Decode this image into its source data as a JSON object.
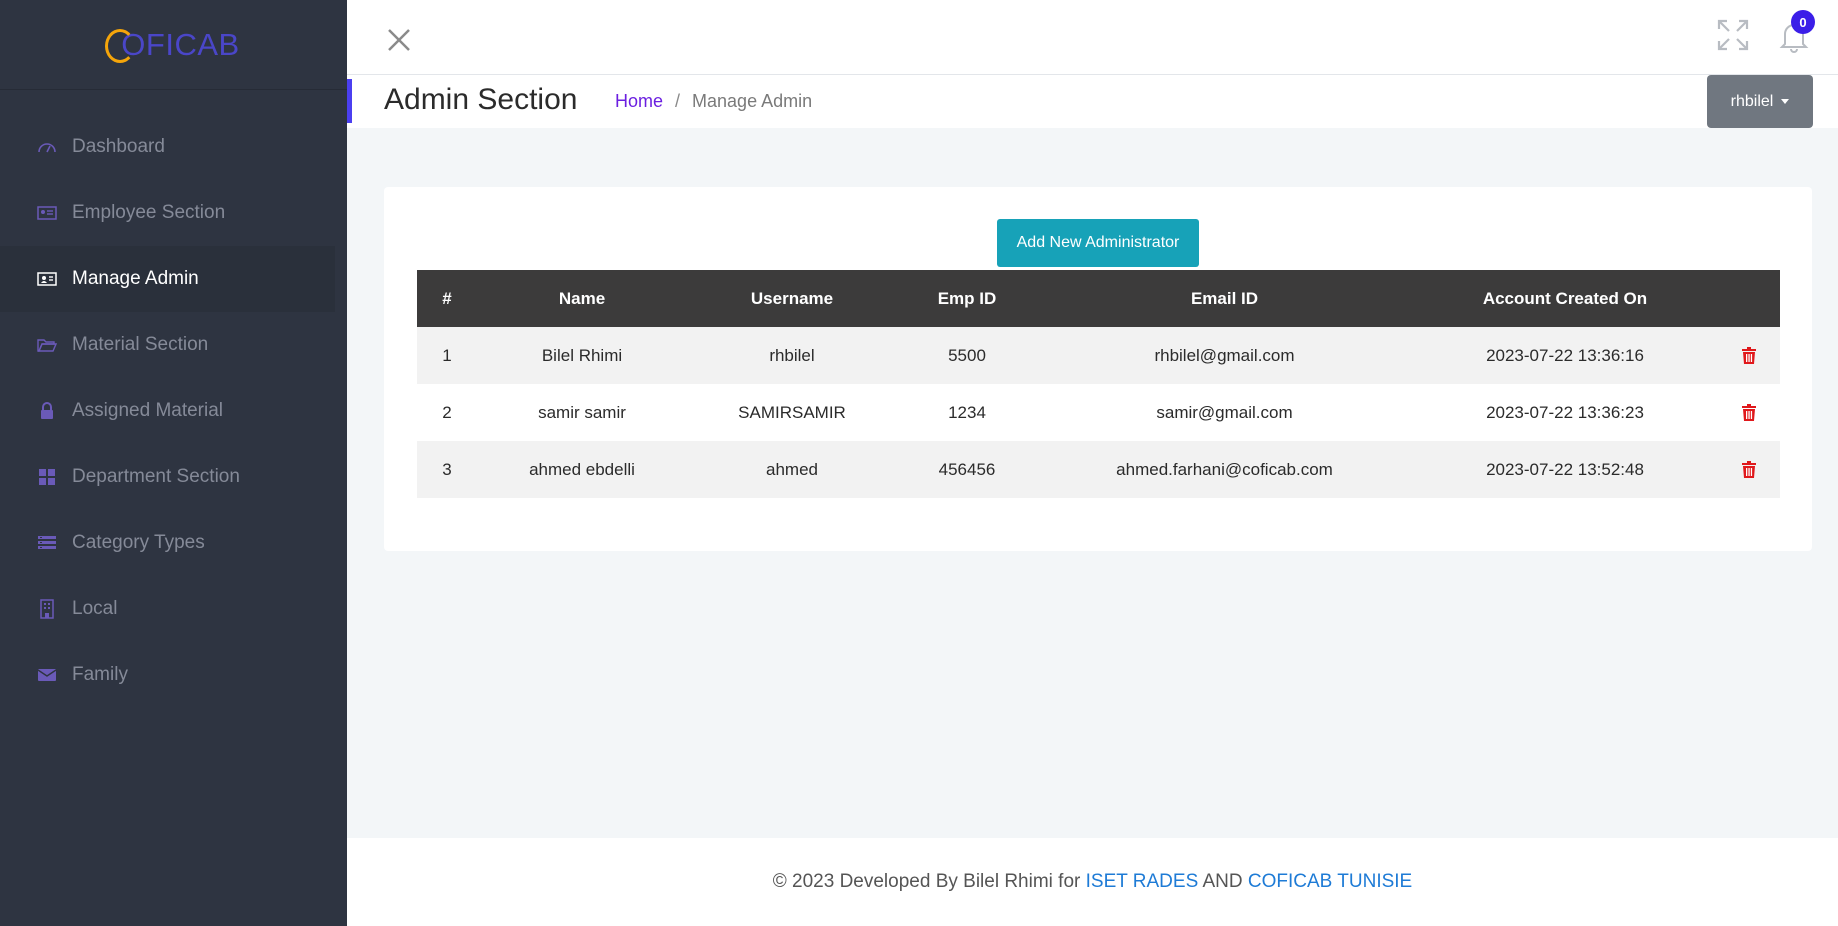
{
  "brand": {
    "logo_text": "OFICAB"
  },
  "sidebar": {
    "items": [
      {
        "label": "Dashboard",
        "icon": "gauge-icon"
      },
      {
        "label": "Employee Section",
        "icon": "id-card-icon"
      },
      {
        "label": "Manage Admin",
        "icon": "admin-card-icon"
      },
      {
        "label": "Material Section",
        "icon": "folder-open-icon"
      },
      {
        "label": "Assigned Material",
        "icon": "lock-icon"
      },
      {
        "label": "Department Section",
        "icon": "grid-icon"
      },
      {
        "label": "Category Types",
        "icon": "list-icon"
      },
      {
        "label": "Local",
        "icon": "building-icon"
      },
      {
        "label": "Family",
        "icon": "envelope-icon"
      }
    ],
    "active_index": 2
  },
  "topbar": {
    "notification_count": "0"
  },
  "header": {
    "title": "Admin Section",
    "breadcrumb": {
      "home": "Home",
      "separator": "/",
      "current": "Manage Admin"
    },
    "user": "rhbilel"
  },
  "main": {
    "add_button": "Add New Administrator",
    "table": {
      "columns": [
        "#",
        "Name",
        "Username",
        "Emp ID",
        "Email ID",
        "Account Created On",
        ""
      ],
      "rows": [
        [
          "1",
          "Bilel Rhimi",
          "rhbilel",
          "5500",
          "rhbilel@gmail.com",
          "2023-07-22 13:36:16"
        ],
        [
          "2",
          "samir samir",
          "SAMIRSAMIR",
          "1234",
          "samir@gmail.com",
          "2023-07-22 13:36:23"
        ],
        [
          "3",
          "ahmed ebdelli",
          "ahmed",
          "456456",
          "ahmed.farhani@coficab.com",
          "2023-07-22 13:52:48"
        ]
      ]
    }
  },
  "footer": {
    "prefix": "© 2023 Developed By Bilel Rhimi for ",
    "link1": "ISET RADES",
    "middle": " AND ",
    "link2": "COFICAB TUNISIE"
  },
  "colors": {
    "sidebar_bg": "#2e3441",
    "accent": "#4b3ff0",
    "button_info": "#17a2b8",
    "table_header": "#3c3b3b",
    "delete": "#e0181b",
    "link": "#1e7bd6"
  }
}
